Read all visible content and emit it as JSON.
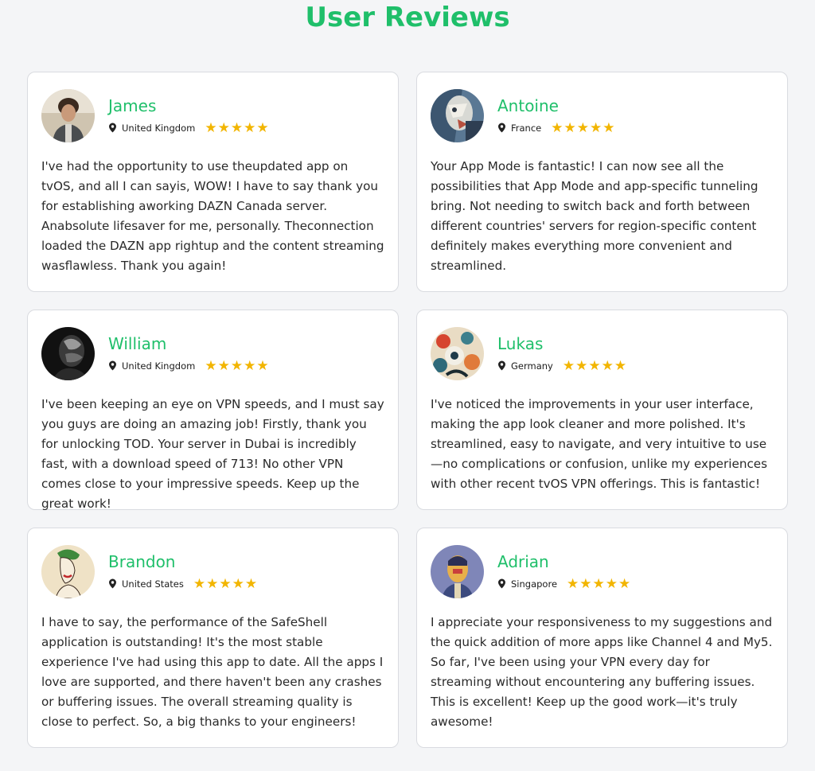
{
  "title": "User Reviews",
  "colors": {
    "accent": "#1fbf6a",
    "star": "#f2b500"
  },
  "reviews": [
    {
      "name": "James",
      "country": "United Kingdom",
      "rating": 5,
      "text": "I've had the opportunity to use theupdated app on tvOS, and all I can sayis, WOW! I have to say thank you for establishing aworking DAZN Canada server. Anabsolute lifesaver for me, personally. Theconnection loaded the DAZN app rightup and the content streaming wasflawless. Thank you again!"
    },
    {
      "name": "Antoine",
      "country": "France",
      "rating": 5,
      "text": "Your App Mode is fantastic! I can now see all the possibilities that App Mode and app-specific tunneling bring. Not needing to switch back and forth between different countries' servers for region-specific content definitely makes everything more convenient and streamlined."
    },
    {
      "name": "William",
      "country": "United Kingdom",
      "rating": 5,
      "text": "I've been keeping an eye on VPN speeds, and I must say you guys are doing an amazing job! Firstly, thank you for unlocking TOD. Your server in Dubai is incredibly fast, with a download speed of 713! No other VPN comes close to your impressive speeds. Keep up the great work!"
    },
    {
      "name": "Lukas",
      "country": "Germany",
      "rating": 5,
      "text": "I've noticed the improvements in your user interface, making the app look cleaner and more polished. It's streamlined, easy to navigate, and very intuitive to use—no complications or confusion, unlike my experiences with other recent tvOS VPN offerings. This is fantastic!"
    },
    {
      "name": "Brandon",
      "country": "United States",
      "rating": 5,
      "text": "I have to say, the performance of the SafeShell application is outstanding! It's the most stable experience I've had using this app to date. All the apps I love are supported, and there haven't been any crashes or buffering issues. The overall streaming quality is close to perfect. So, a big thanks to your engineers!"
    },
    {
      "name": "Adrian",
      "country": "Singapore",
      "rating": 5,
      "text": "I appreciate your responsiveness to my suggestions and the quick addition of more apps like Channel 4 and My5. So far, I've been using your VPN every day for streaming without encountering any buffering issues. This is excellent! Keep up the good work—it's truly awesome!"
    }
  ]
}
